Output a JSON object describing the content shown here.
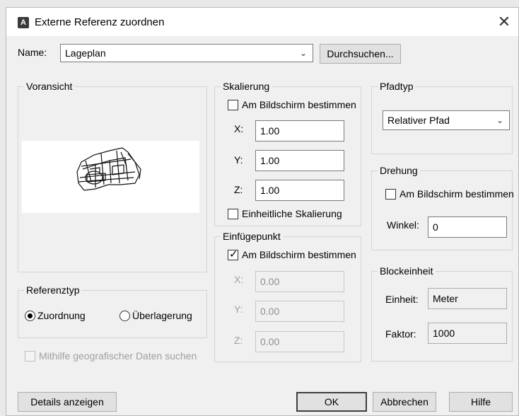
{
  "window": {
    "title": "Externe Referenz zuordnen",
    "app_icon": "autocad-icon",
    "close_icon": "close-icon"
  },
  "name": {
    "label": "Name:",
    "value": "Lageplan",
    "browse_label": "Durchsuchen..."
  },
  "preview": {
    "title": "Voransicht"
  },
  "reference_type": {
    "title": "Referenztyp",
    "attach_label": "Zuordnung",
    "overlay_label": "Überlagerung",
    "selected": "Zuordnung"
  },
  "geo": {
    "label": "Mithilfe geografischer Daten suchen",
    "checked": false,
    "enabled": false
  },
  "scale": {
    "title": "Skalierung",
    "onscreen_label": "Am Bildschirm bestimmen",
    "onscreen_checked": false,
    "x_label": "X:",
    "x": "1.00",
    "y_label": "Y:",
    "y": "1.00",
    "z_label": "Z:",
    "z": "1.00",
    "uniform_label": "Einheitliche Skalierung",
    "uniform_checked": false
  },
  "insertion": {
    "title": "Einfügepunkt",
    "onscreen_label": "Am Bildschirm bestimmen",
    "onscreen_checked": true,
    "x_label": "X:",
    "x": "0.00",
    "y_label": "Y:",
    "y": "0.00",
    "z_label": "Z:",
    "z": "0.00"
  },
  "path_type": {
    "title": "Pfadtyp",
    "value": "Relativer Pfad"
  },
  "rotation": {
    "title": "Drehung",
    "onscreen_label": "Am Bildschirm bestimmen",
    "onscreen_checked": false,
    "angle_label": "Winkel:",
    "angle": "0"
  },
  "block_unit": {
    "title": "Blockeinheit",
    "unit_label": "Einheit:",
    "unit": "Meter",
    "factor_label": "Faktor:",
    "factor": "1000"
  },
  "buttons": {
    "details": "Details anzeigen",
    "ok": "OK",
    "cancel": "Abbrechen",
    "help": "Hilfe"
  }
}
